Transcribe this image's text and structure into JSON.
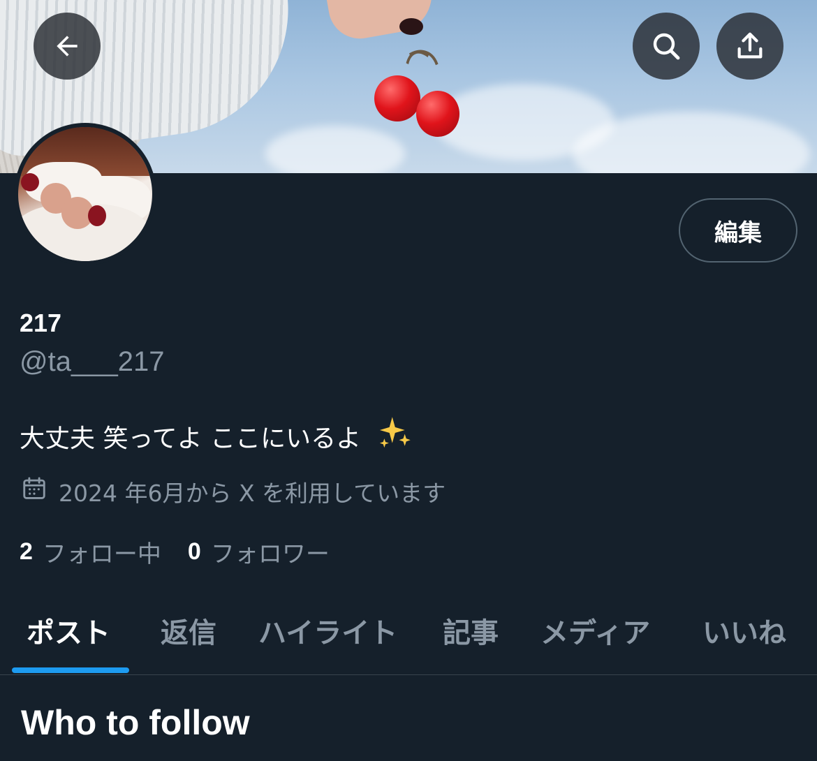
{
  "header": {
    "back_icon": "arrow-left-icon",
    "search_icon": "search-icon",
    "share_icon": "share-upload-icon"
  },
  "profile": {
    "display_name": "217",
    "handle": "@ta___217",
    "bio": "大丈夫 笑ってよ ここにいるよ",
    "bio_emoji": "sparkles-icon",
    "joined": "2024 年6月から X を利用しています",
    "following_count": "2",
    "following_label": "フォロー中",
    "followers_count": "0",
    "followers_label": "フォロワー",
    "edit_label": "編集"
  },
  "tabs": [
    {
      "label": "ポスト",
      "active": true
    },
    {
      "label": "返信",
      "active": false
    },
    {
      "label": "ハイライト",
      "active": false
    },
    {
      "label": "記事",
      "active": false
    },
    {
      "label": "メディア",
      "active": false
    },
    {
      "label": "いいね",
      "active": false
    }
  ],
  "who_to_follow": {
    "title": "Who to follow"
  },
  "colors": {
    "background": "#15202b",
    "accent": "#1d9bf0",
    "muted_text": "#8b98a5",
    "border": "#536471"
  }
}
